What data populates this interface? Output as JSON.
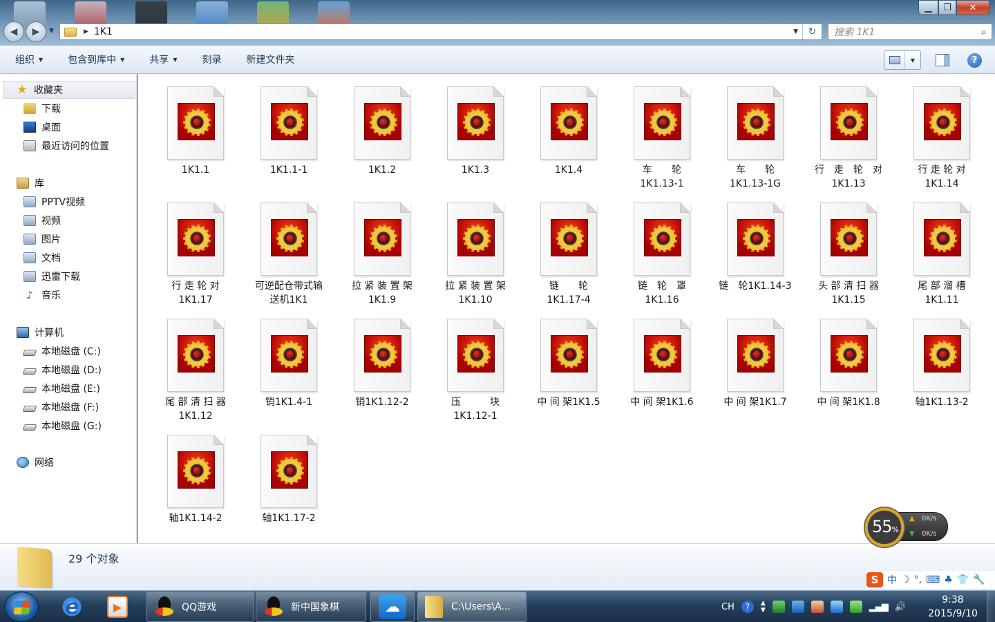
{
  "window": {
    "address_path": "1K1",
    "search_placeholder": "搜索 1K1",
    "controls": {
      "minimize": "▁",
      "maximize": "❐",
      "close": "✕"
    }
  },
  "toolbar": {
    "organize": "组织",
    "include_in_library": "包含到库中",
    "share": "共享",
    "burn": "刻录",
    "new_folder": "新建文件夹",
    "help": "?"
  },
  "sidebar": {
    "favorites": {
      "label": "收藏夹",
      "items": [
        "下载",
        "桌面",
        "最近访问的位置"
      ]
    },
    "libraries": {
      "label": "库",
      "items": [
        "PPTV视频",
        "视频",
        "图片",
        "文档",
        "迅雷下载",
        "音乐"
      ]
    },
    "computer": {
      "label": "计算机",
      "items": [
        "本地磁盘 (C:)",
        "本地磁盘 (D:)",
        "本地磁盘 (E:)",
        "本地磁盘 (F:)",
        "本地磁盘 (G:)"
      ]
    },
    "network": {
      "label": "网络"
    }
  },
  "files": [
    "1K1.1",
    "1K1.1-1",
    "1K1.2",
    "1K1.3",
    "1K1.4",
    "车　　轮\n1K1.13-1",
    "车　　轮\n1K1.13-1G",
    "行　走　轮　对\n1K1.13",
    "行 走 轮 对\n1K1.14",
    "行 走 轮 对\n1K1.17",
    "可逆配仓带式输\n送机1K1",
    "拉 紧 装 置 架\n1K1.9",
    "拉 紧 装 置 架\n1K1.10",
    "链　　轮\n1K1.17-4",
    "链　轮　罩\n1K1.16",
    "链　轮1K1.14-3",
    "头 部 清 扫 器\n1K1.15",
    "尾 部 溜 槽\n1K1.11",
    "尾 部 清 扫 器\n1K1.12",
    "销1K1.4-1",
    "销1K1.12-2",
    "压　　　块\n1K1.12-1",
    "中 间 架1K1.5",
    "中 间 架1K1.6",
    "中 间 架1K1.7",
    "中 间 架1K1.8",
    "轴1K1.13-2",
    "轴1K1.14-2",
    "轴1K1.17-2"
  ],
  "status": {
    "object_count": "29 个对象"
  },
  "speed_widget": {
    "percent": "55",
    "percent_sign": "%",
    "upload": "0K/s",
    "download": "0K/s"
  },
  "ime": {
    "logo": "S",
    "items": [
      "中",
      "☽",
      "°,",
      "⌨",
      "♣",
      "👕",
      "🔧"
    ]
  },
  "taskbar": {
    "tasks": [
      "QQ游戏",
      "新中国象棋",
      "C:\\Users\\A..."
    ],
    "tray": {
      "lang": "CH"
    },
    "clock": {
      "time": "9:38",
      "date": "2015/9/10"
    }
  }
}
